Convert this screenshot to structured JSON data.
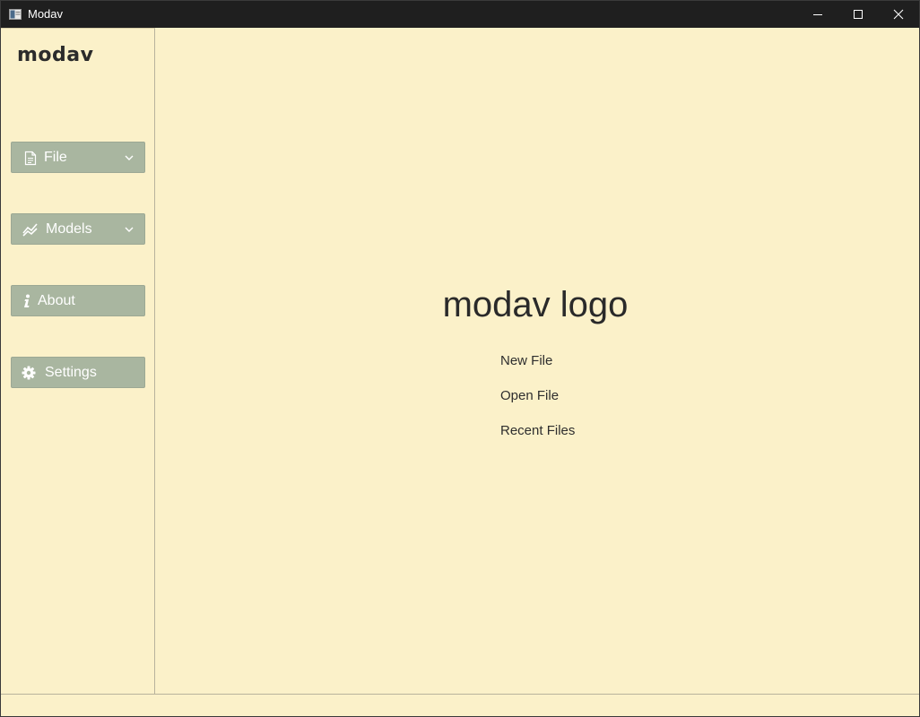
{
  "window": {
    "title": "Modav",
    "colors": {
      "titlebar": "#1f1f1f",
      "background": "#fbf1c9",
      "button": "#a9b6a0",
      "text": "#2a2a2a"
    }
  },
  "sidebar": {
    "brand": "modav",
    "items": [
      {
        "label": "File",
        "icon": "file-icon",
        "has_dropdown": true
      },
      {
        "label": "Models",
        "icon": "chart-line-icon",
        "has_dropdown": true
      },
      {
        "label": "About",
        "icon": "info-icon",
        "has_dropdown": false
      },
      {
        "label": "Settings",
        "icon": "gear-icon",
        "has_dropdown": false
      }
    ]
  },
  "main": {
    "logo_text": "modav logo",
    "links": [
      {
        "label": "New File"
      },
      {
        "label": "Open File"
      },
      {
        "label": "Recent Files"
      }
    ]
  }
}
